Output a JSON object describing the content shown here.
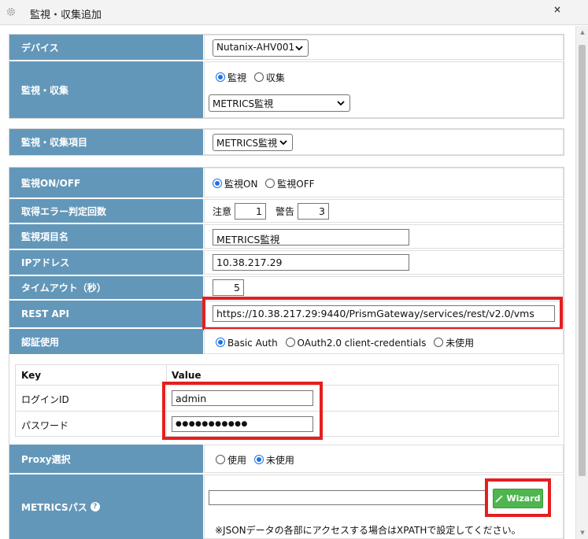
{
  "window": {
    "title": "監視・収集追加",
    "close": "×",
    "gear_icon": "gear-icon"
  },
  "colors": {
    "label_bg": "#6397b9",
    "highlight": "#e41f1f",
    "wizard_bg": "#4fb64f",
    "radio_on": "#1a73e8"
  },
  "device": {
    "label": "デバイス",
    "value": "Nutanix-AHV001"
  },
  "monitor_collect": {
    "label": "監視・収集",
    "options": [
      "監視",
      "収集"
    ],
    "selected": "監視",
    "select_value": "METRICS監視"
  },
  "item": {
    "label": "監視・収集項目",
    "value": "METRICS監視"
  },
  "monitor_onoff": {
    "label": "監視ON/OFF",
    "options": [
      "監視ON",
      "監視OFF"
    ],
    "selected": "監視ON"
  },
  "error_count": {
    "label": "取得エラー判定回数",
    "caution_label": "注意",
    "caution_value": "1",
    "warning_label": "警告",
    "warning_value": "3"
  },
  "item_name": {
    "label": "監視項目名",
    "value": "METRICS監視"
  },
  "ip": {
    "label": "IPアドレス",
    "value": "10.38.217.29"
  },
  "timeout": {
    "label": "タイムアウト（秒）",
    "value": "5"
  },
  "rest_api": {
    "label": "REST API",
    "value": "https://10.38.217.29:9440/PrismGateway/services/rest/v2.0/vms"
  },
  "auth": {
    "label": "認証使用",
    "options": [
      "Basic Auth",
      "OAuth2.0 client-credentials",
      "未使用"
    ],
    "selected": "Basic Auth"
  },
  "kv": {
    "key_header": "Key",
    "value_header": "Value",
    "rows": [
      {
        "key": "ログインID",
        "value": "admin"
      },
      {
        "key": "パスワード",
        "value": "●●●●●●●●●●●"
      }
    ]
  },
  "proxy": {
    "label": "Proxy選択",
    "options": [
      "使用",
      "未使用"
    ],
    "selected": "未使用"
  },
  "metrics_path": {
    "label": "METRICSパス",
    "help_icon": "question-circle-icon",
    "value": "",
    "wizard_label": "Wizard",
    "note": "※JSONデータの各部にアクセスする場合はXPATHで設定してください。"
  }
}
